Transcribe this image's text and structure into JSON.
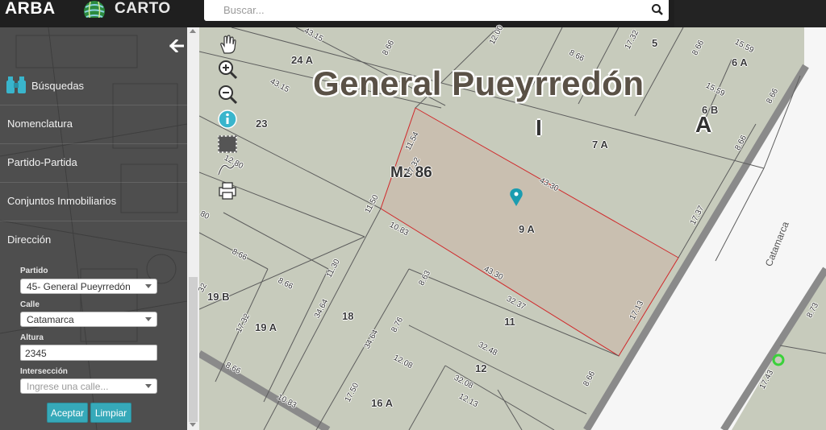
{
  "header": {
    "brand": "ARBA",
    "carto": "CARTO",
    "search_placeholder": "Buscar..."
  },
  "sidebar": {
    "items": [
      {
        "label": "Búsquedas"
      },
      {
        "label": "Nomenclatura"
      },
      {
        "label": "Partido-Partida"
      },
      {
        "label": "Conjuntos Inmobiliarios"
      },
      {
        "label": "Dirección"
      }
    ],
    "form": {
      "partido_label": "Partido",
      "partido_value": "45- General Pueyrredón",
      "calle_label": "Calle",
      "calle_value": "Catamarca",
      "altura_label": "Altura",
      "altura_value": "2345",
      "interseccion_label": "Intersección",
      "interseccion_placeholder": "Ingrese una calle...",
      "aceptar_label": "Aceptar",
      "limpiar_label": "Limpiar"
    }
  },
  "toolbar": {
    "icons": [
      "pan-hand-icon",
      "zoom-in-icon",
      "zoom-out-icon",
      "info-icon",
      "select-area-icon",
      "measure-icon",
      "print-icon"
    ]
  },
  "map": {
    "title": "General Pueyrredón",
    "letter_i": "I",
    "letter_a": "A",
    "manzana": "Mz 86",
    "street": "Catamarca",
    "lots": [
      "24 A",
      "5",
      "6 A",
      "6 B",
      "23",
      "7 A",
      "9 A",
      "19 B",
      "19 A",
      "18",
      "11",
      "12",
      "16 A"
    ],
    "dimensions": [
      "43.15",
      "8.66",
      "12.00",
      "17.32",
      "8.66",
      "15.59",
      "8.66",
      "43.15",
      "15.59",
      "8.66",
      "11.54",
      "17.32",
      "8.66",
      "12.80",
      "43.30",
      "11.50",
      "10.83",
      "17.37",
      "8.66",
      "8.63",
      "11.30",
      "43.30",
      "8.66",
      "34.64",
      "32.37",
      "17.32",
      "17.13",
      "8.76",
      "32.48",
      "34.64",
      "12.08",
      "32.08",
      "8.66",
      "17.50",
      "12.13",
      "10.83",
      "8.66",
      "8.73",
      "17.43",
      "80",
      "32"
    ],
    "colors": {
      "parcel_fill": "#c7cbbc",
      "selected_fill": "#c9bfb0",
      "selected_border": "#d0292b",
      "road": "#8a8a8a",
      "marker": "#1a9cb0",
      "green_marker": "#3ad13a"
    }
  }
}
